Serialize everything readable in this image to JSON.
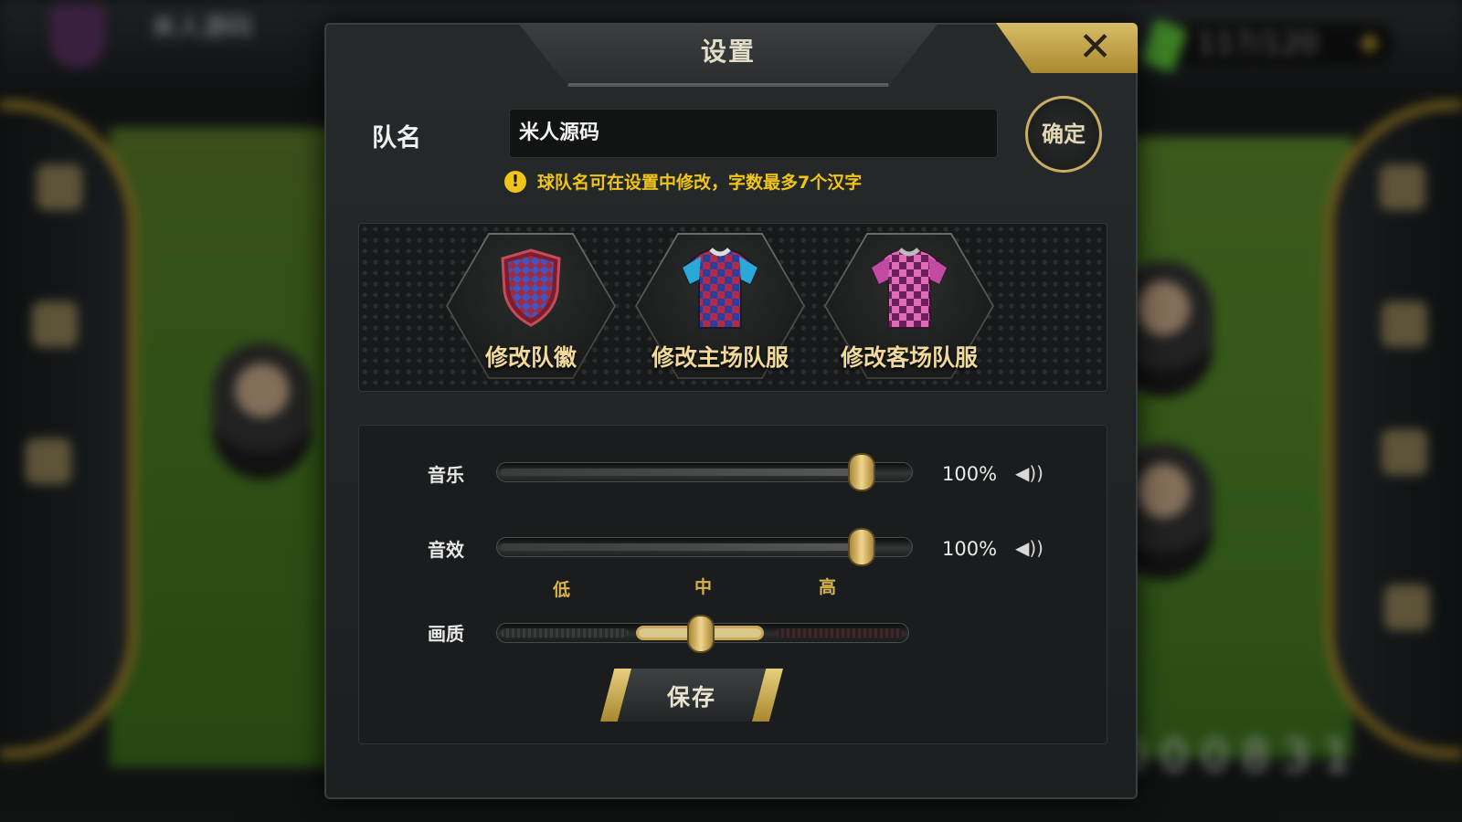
{
  "background": {
    "team_name": "米人源码",
    "energy_text": "117/120",
    "score_digits": "000831"
  },
  "dialog": {
    "title": "设置",
    "close_icon": "close-icon",
    "team_name_label": "队名",
    "team_name_value": "米人源码",
    "confirm_label": "确定",
    "hint_icon": "warning-icon",
    "hint_text": "球队名可在设置中修改，字数最多7个汉字",
    "customization": [
      {
        "label": "修改队徽",
        "icon": "crest-icon"
      },
      {
        "label": "修改主场队服",
        "icon": "home-jersey-icon"
      },
      {
        "label": "修改客场队服",
        "icon": "away-jersey-icon"
      }
    ],
    "audio": {
      "music_label": "音乐",
      "music_value": "100%",
      "music_level": 1.0,
      "sfx_label": "音效",
      "sfx_value": "100%",
      "sfx_level": 1.0
    },
    "quality": {
      "label": "画质",
      "options": [
        "低",
        "中",
        "高"
      ],
      "selected": "中"
    },
    "save_label": "保存"
  },
  "colors": {
    "accent_gold": "#c9ad62",
    "hint_yellow": "#f0c419",
    "crest_red": "#a02a3e",
    "crest_blue": "#3a56c8",
    "away_pink": "#d05aa8"
  }
}
